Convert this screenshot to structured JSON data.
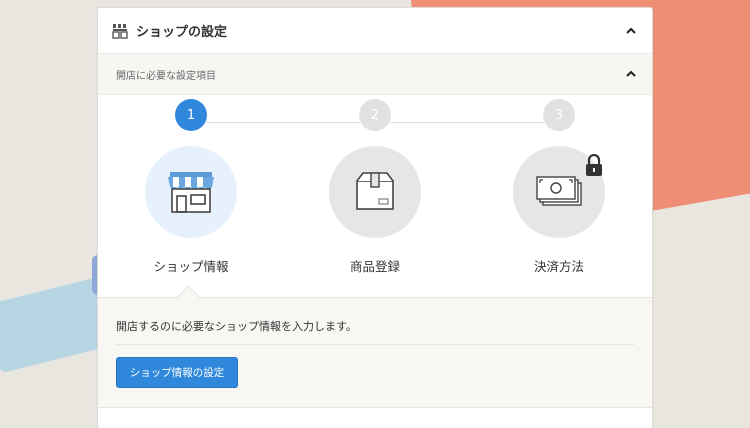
{
  "header": {
    "title": "ショップの設定"
  },
  "section": {
    "title": "開店に必要な設定項目"
  },
  "steps": [
    {
      "number": "1",
      "label": "ショップ情報",
      "state": "active",
      "icon": "storefront-icon"
    },
    {
      "number": "2",
      "label": "商品登録",
      "state": "inactive",
      "icon": "box-icon"
    },
    {
      "number": "3",
      "label": "決済方法",
      "state": "locked",
      "icon": "money-icon"
    }
  ],
  "info": {
    "text": "開店するのに必要なショップ情報を入力します。",
    "button_label": "ショップ情報の設定"
  },
  "colors": {
    "accent": "#2f88db",
    "inactive_step": "#e1e1e1",
    "active_circle": "#e6f1fb",
    "inactive_circle": "#e6e6e6"
  }
}
